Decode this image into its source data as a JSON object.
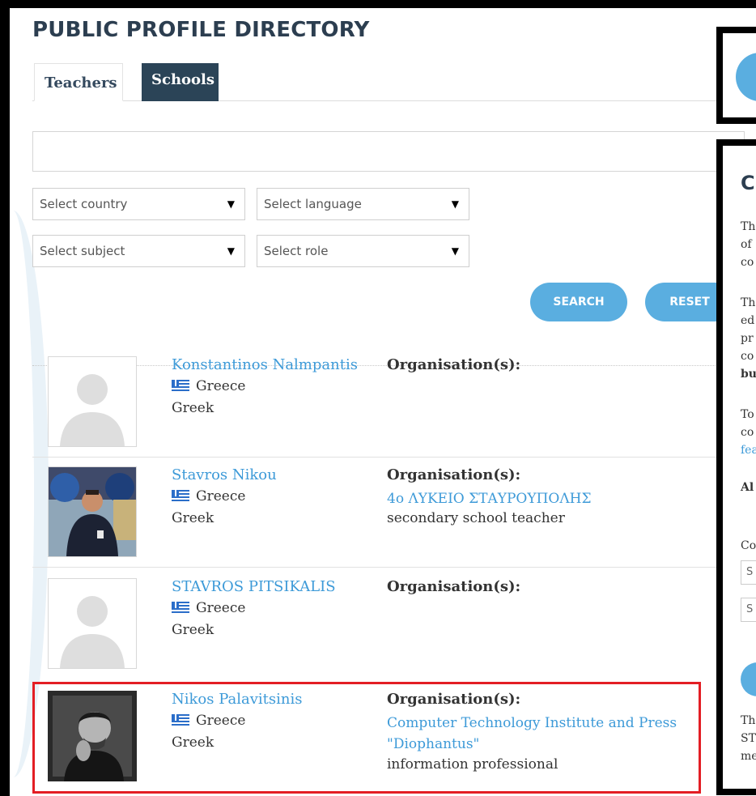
{
  "page": {
    "title": "PUBLIC PROFILE DIRECTORY"
  },
  "tabs": [
    {
      "label": "Teachers",
      "active": true
    },
    {
      "label": "Schools",
      "active": false
    }
  ],
  "search": {
    "value": "",
    "placeholder": ""
  },
  "filters": {
    "country": "Select country",
    "language": "Select language",
    "subject": "Select subject",
    "role": "Select role",
    "arrow": "▼"
  },
  "buttons": {
    "search": "SEARCH",
    "reset": "RESET"
  },
  "org_label": "Organisation(s):",
  "profiles": [
    {
      "name": "Konstantinos Nalmpantis",
      "country": "Greece",
      "language": "Greek",
      "organisation": "",
      "role": "",
      "avatar": "placeholder-silhouette"
    },
    {
      "name": "Stavros Nikou",
      "country": "Greece",
      "language": "Greek",
      "organisation": "4ο ΛΥΚΕΙΟ ΣΤΑΥΡΟΥΠΟΛΗΣ",
      "role": "secondary school teacher",
      "avatar": "photo"
    },
    {
      "name": "STAVROS PITSIKALIS",
      "country": "Greece",
      "language": "Greek",
      "organisation": "",
      "role": "",
      "avatar": "placeholder-silhouette"
    },
    {
      "name": "Nikos Palavitsinis",
      "country": "Greece",
      "language": "Greek",
      "organisation_line1": "Computer Technology Institute and Press",
      "organisation_line2": "\"Diophantus\"",
      "role": "information professional",
      "avatar": "photo-bw",
      "highlighted": true
    }
  ],
  "side_panel": {
    "heading": "C",
    "p1": [
      "Th",
      "of",
      "co"
    ],
    "p2": [
      "Th",
      "ed",
      "pr",
      "co",
      "bu"
    ],
    "p3": [
      "To",
      "co",
      "fea"
    ],
    "bold": "Al",
    "label": "Co",
    "inputs": [
      "S",
      "S"
    ],
    "p4": [
      "Th",
      "ST",
      "me"
    ]
  },
  "colors": {
    "accent": "#5aaee0",
    "dark_tab": "#2b4457",
    "link": "#3d9ad8",
    "highlight": "#e31e24"
  }
}
